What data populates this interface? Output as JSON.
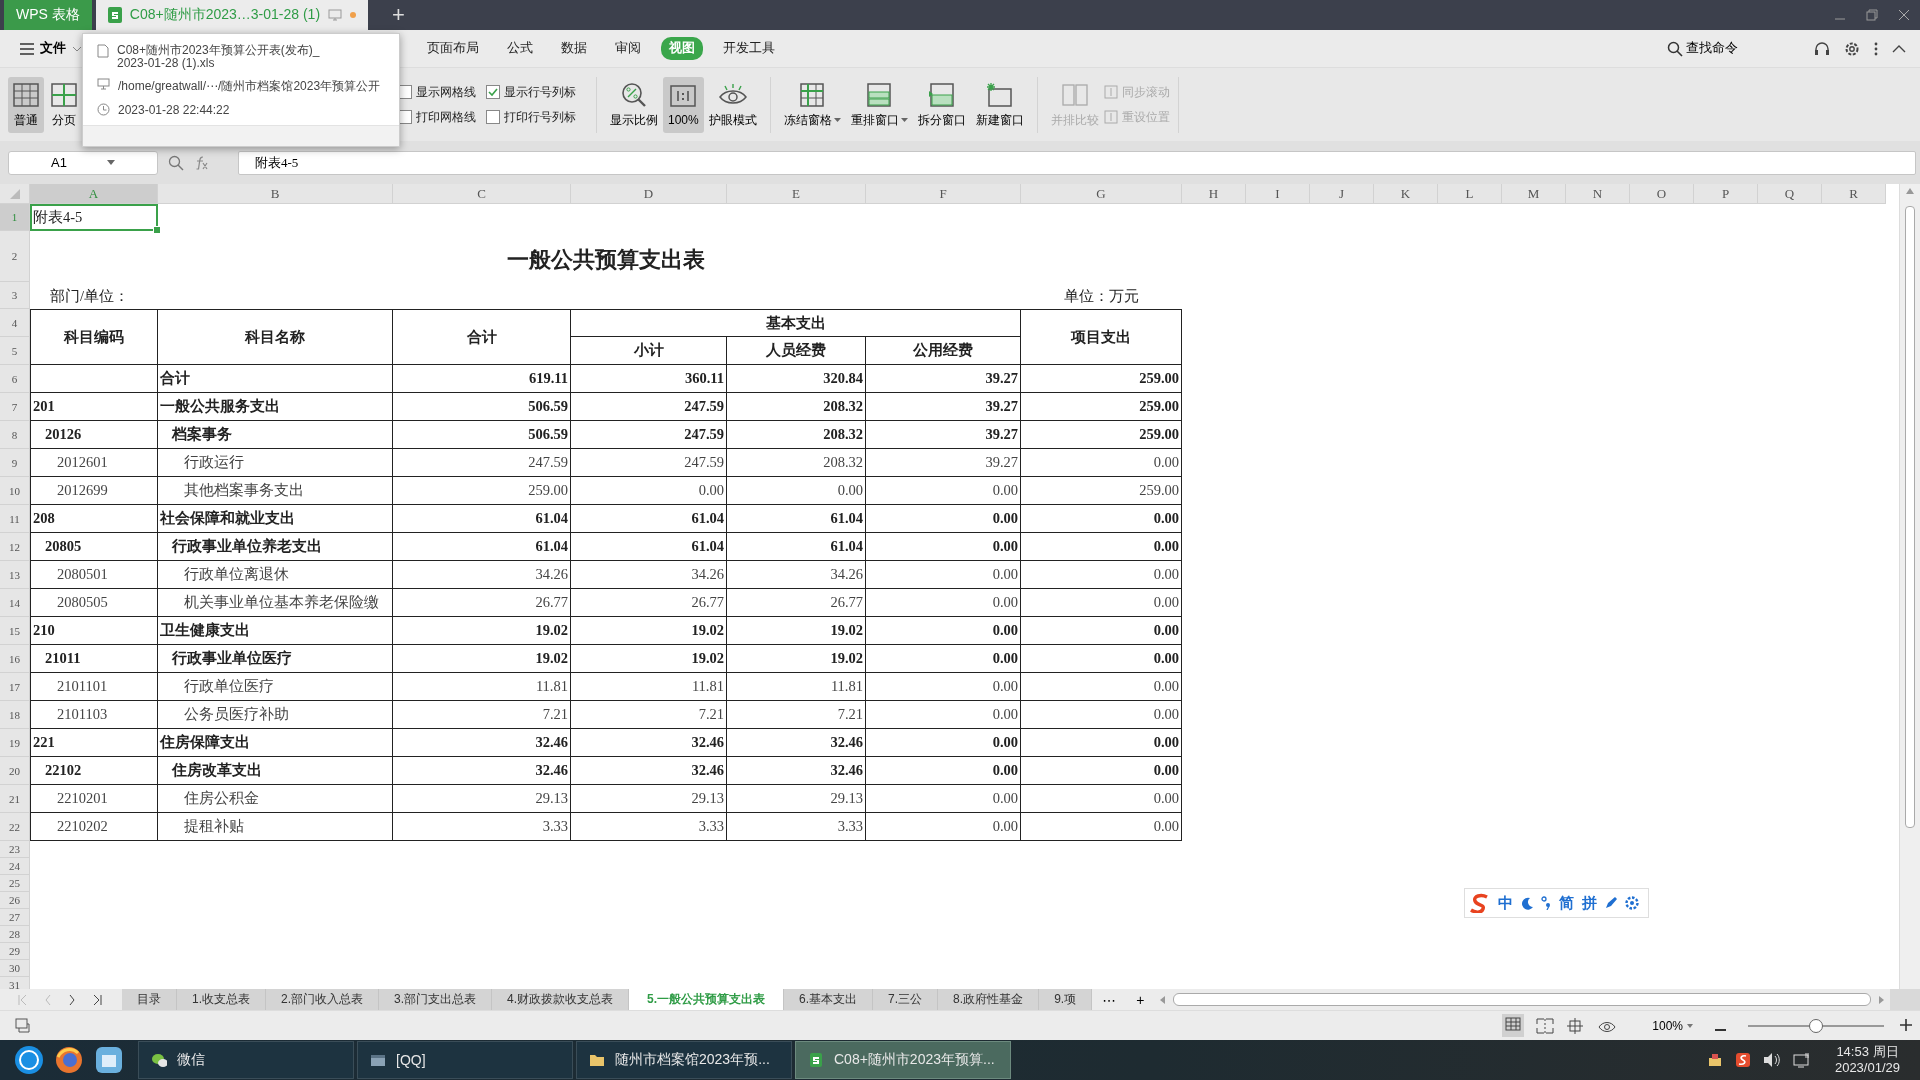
{
  "title_bar": {
    "app_tab": "WPS 表格",
    "document_tab": {
      "title": "C08+随州市2023…3-01-28 (1)",
      "unsaved": true
    },
    "new_tab": "+"
  },
  "tooltip": {
    "file_name_lines": [
      "C08+随州市2023年预算公开表(发布)_",
      "2023-01-28 (1).xls"
    ],
    "path": "/home/greatwall/⋯/随州市档案馆2023年预算公开",
    "modified": "2023-01-28 22:44:22"
  },
  "menu": {
    "file": "文件",
    "tabs": [
      {
        "label": "页面布局",
        "selected": false
      },
      {
        "label": "公式",
        "selected": false
      },
      {
        "label": "数据",
        "selected": false
      },
      {
        "label": "审阅",
        "selected": false
      },
      {
        "label": "视图",
        "selected": true
      },
      {
        "label": "开发工具",
        "selected": false
      }
    ],
    "search": "查找命令"
  },
  "ribbon": {
    "view_buttons": [
      {
        "label": "普通",
        "kind": "normal",
        "selected": true
      },
      {
        "label": "分页",
        "kind": "pagebreak",
        "selected": false
      }
    ],
    "checkboxes": [
      {
        "label": "显示网格线",
        "checked": false
      },
      {
        "label": "显示行号列标",
        "checked": true
      },
      {
        "label": "打印网格线",
        "checked": false
      },
      {
        "label": "打印行号列标",
        "checked": false
      }
    ],
    "tools": [
      {
        "label": "显示比例",
        "kind": "zoom",
        "selected": false,
        "dropdown": false,
        "disabled": false
      },
      {
        "label": "100%",
        "kind": "actual",
        "selected": true,
        "dropdown": false,
        "disabled": false
      },
      {
        "label": "护眼模式",
        "kind": "eye",
        "selected": false,
        "dropdown": false,
        "disabled": false
      },
      {
        "label": "冻结窗格",
        "kind": "freeze",
        "selected": false,
        "dropdown": true,
        "disabled": false
      },
      {
        "label": "重排窗口",
        "kind": "arrange",
        "selected": false,
        "dropdown": true,
        "disabled": false
      },
      {
        "label": "拆分窗口",
        "kind": "split",
        "selected": false,
        "dropdown": false,
        "disabled": false
      },
      {
        "label": "新建窗口",
        "kind": "newwin",
        "selected": false,
        "dropdown": false,
        "disabled": false
      },
      {
        "label": "并排比较",
        "kind": "compare",
        "selected": false,
        "dropdown": false,
        "disabled": true
      }
    ],
    "small_tools": [
      {
        "label": "同步滚动",
        "disabled": true
      },
      {
        "label": "重设位置",
        "disabled": true
      }
    ]
  },
  "formula_bar": {
    "cell": "A1",
    "content": "附表4-5"
  },
  "sheet": {
    "columns": [
      {
        "label": "A",
        "selected": true
      },
      {
        "label": "B",
        "selected": false
      },
      {
        "label": "C",
        "selected": false
      },
      {
        "label": "D",
        "selected": false
      },
      {
        "label": "E",
        "selected": false
      },
      {
        "label": "F",
        "selected": false
      },
      {
        "label": "G",
        "selected": false
      },
      {
        "label": "H",
        "selected": false
      },
      {
        "label": "I",
        "selected": false
      },
      {
        "label": "J",
        "selected": false
      },
      {
        "label": "K",
        "selected": false
      },
      {
        "label": "L",
        "selected": false
      },
      {
        "label": "M",
        "selected": false
      },
      {
        "label": "N",
        "selected": false
      },
      {
        "label": "O",
        "selected": false
      },
      {
        "label": "P",
        "selected": false
      },
      {
        "label": "Q",
        "selected": false
      },
      {
        "label": "R",
        "selected": false
      }
    ],
    "row_numbers": [
      {
        "label": "1",
        "selected": true
      },
      {
        "label": "2",
        "selected": false
      },
      {
        "label": "3",
        "selected": false
      },
      {
        "label": "4",
        "selected": false
      },
      {
        "label": "5",
        "selected": false
      },
      {
        "label": "6",
        "selected": false
      },
      {
        "label": "7",
        "selected": false
      },
      {
        "label": "8",
        "selected": false
      },
      {
        "label": "9",
        "selected": false
      },
      {
        "label": "10",
        "selected": false
      },
      {
        "label": "11",
        "selected": false
      },
      {
        "label": "12",
        "selected": false
      },
      {
        "label": "13",
        "selected": false
      },
      {
        "label": "14",
        "selected": false
      },
      {
        "label": "15",
        "selected": false
      },
      {
        "label": "16",
        "selected": false
      },
      {
        "label": "17",
        "selected": false
      },
      {
        "label": "18",
        "selected": false
      },
      {
        "label": "19",
        "selected": false
      },
      {
        "label": "20",
        "selected": false
      },
      {
        "label": "21",
        "selected": false
      },
      {
        "label": "22",
        "selected": false
      },
      {
        "label": "23",
        "selected": false
      },
      {
        "label": "24",
        "selected": false
      },
      {
        "label": "25",
        "selected": false
      },
      {
        "label": "26",
        "selected": false
      },
      {
        "label": "27",
        "selected": false
      },
      {
        "label": "28",
        "selected": false
      },
      {
        "label": "29",
        "selected": false
      },
      {
        "label": "30",
        "selected": false
      },
      {
        "label": "31",
        "selected": false
      }
    ],
    "note": "附表4-5",
    "title": "一般公共预算支出表",
    "department_label": "部门/单位：",
    "unit": "单位：万元",
    "header": {
      "code": "科目编码",
      "name": "科目名称",
      "total": "合计",
      "basic": "基本支出",
      "subtotal": "小计",
      "personnel": "人员经费",
      "public": "公用经费",
      "project": "项目支出"
    },
    "rows": [
      {
        "kind": "total",
        "name": "合计",
        "values": [
          "619.11",
          "360.11",
          "320.84",
          "39.27",
          "259.00"
        ]
      },
      {
        "kind": "category",
        "code": "201",
        "name": "一般公共服务支出",
        "values": [
          "506.59",
          "247.59",
          "208.32",
          "39.27",
          "259.00"
        ]
      },
      {
        "kind": "subcategory",
        "code": "20126",
        "name": "档案事务",
        "values": [
          "506.59",
          "247.59",
          "208.32",
          "39.27",
          "259.00"
        ]
      },
      {
        "kind": "item",
        "code": "2012601",
        "name": "行政运行",
        "values": [
          "247.59",
          "247.59",
          "208.32",
          "39.27",
          "0.00"
        ]
      },
      {
        "kind": "item",
        "code": "2012699",
        "name": "其他档案事务支出",
        "values": [
          "259.00",
          "0.00",
          "0.00",
          "0.00",
          "259.00"
        ]
      },
      {
        "kind": "category",
        "code": "208",
        "name": "社会保障和就业支出",
        "values": [
          "61.04",
          "61.04",
          "61.04",
          "0.00",
          "0.00"
        ]
      },
      {
        "kind": "subcategory",
        "code": "20805",
        "name": "行政事业单位养老支出",
        "values": [
          "61.04",
          "61.04",
          "61.04",
          "0.00",
          "0.00"
        ]
      },
      {
        "kind": "item",
        "code": "2080501",
        "name": "行政单位离退休",
        "values": [
          "34.26",
          "34.26",
          "34.26",
          "0.00",
          "0.00"
        ]
      },
      {
        "kind": "item",
        "code": "2080505",
        "name": "机关事业单位基本养老保险缴",
        "values": [
          "26.77",
          "26.77",
          "26.77",
          "0.00",
          "0.00"
        ]
      },
      {
        "kind": "category",
        "code": "210",
        "name": "卫生健康支出",
        "values": [
          "19.02",
          "19.02",
          "19.02",
          "0.00",
          "0.00"
        ]
      },
      {
        "kind": "subcategory",
        "code": "21011",
        "name": "行政事业单位医疗",
        "values": [
          "19.02",
          "19.02",
          "19.02",
          "0.00",
          "0.00"
        ]
      },
      {
        "kind": "item",
        "code": "2101101",
        "name": "行政单位医疗",
        "values": [
          "11.81",
          "11.81",
          "11.81",
          "0.00",
          "0.00"
        ]
      },
      {
        "kind": "item",
        "code": "2101103",
        "name": "公务员医疗补助",
        "values": [
          "7.21",
          "7.21",
          "7.21",
          "0.00",
          "0.00"
        ]
      },
      {
        "kind": "category",
        "code": "221",
        "name": "住房保障支出",
        "values": [
          "32.46",
          "32.46",
          "32.46",
          "0.00",
          "0.00"
        ]
      },
      {
        "kind": "subcategory",
        "code": "22102",
        "name": "住房改革支出",
        "values": [
          "32.46",
          "32.46",
          "32.46",
          "0.00",
          "0.00"
        ]
      },
      {
        "kind": "item",
        "code": "2210201",
        "name": "住房公积金",
        "values": [
          "29.13",
          "29.13",
          "29.13",
          "0.00",
          "0.00"
        ]
      },
      {
        "kind": "item",
        "code": "2210202",
        "name": "提租补贴",
        "values": [
          "3.33",
          "3.33",
          "3.33",
          "0.00",
          "0.00"
        ]
      }
    ]
  },
  "sheet_tabs": {
    "tabs": [
      {
        "label": "目录",
        "selected": false
      },
      {
        "label": "1.收支总表",
        "selected": false
      },
      {
        "label": "2.部门收入总表",
        "selected": false
      },
      {
        "label": "3.部门支出总表",
        "selected": false
      },
      {
        "label": "4.财政拨款收支总表",
        "selected": false
      },
      {
        "label": "5.一般公共预算支出表",
        "selected": true
      },
      {
        "label": "6.基本支出",
        "selected": false
      },
      {
        "label": "7.三公",
        "selected": false
      },
      {
        "label": "8.政府性基金",
        "selected": false
      },
      {
        "label": "9.项",
        "selected": false
      }
    ],
    "more": "⋯",
    "add": "+"
  },
  "ime": {
    "items": [
      {
        "kind": "logo"
      },
      {
        "kind": "text",
        "label": "中"
      },
      {
        "kind": "moon"
      },
      {
        "kind": "punct"
      },
      {
        "kind": "text",
        "label": "简"
      },
      {
        "kind": "text",
        "label": "拼"
      },
      {
        "kind": "pen"
      },
      {
        "kind": "gear"
      }
    ]
  },
  "status_bar": {
    "zoom": "100%",
    "zoom_slider": {
      "level": 0.5
    }
  },
  "taskbar": {
    "windows": [
      {
        "label": "微信",
        "kind": "chat",
        "selected": false
      },
      {
        "label": "[QQ]",
        "kind": "window",
        "selected": false
      },
      {
        "label": "随州市档案馆2023年预...",
        "kind": "folder",
        "selected": false
      },
      {
        "label": "C08+随州市2023年预算...",
        "kind": "sheet",
        "selected": true
      }
    ],
    "clock": {
      "time": "14:53 周日",
      "date": "2023/01/29"
    }
  }
}
